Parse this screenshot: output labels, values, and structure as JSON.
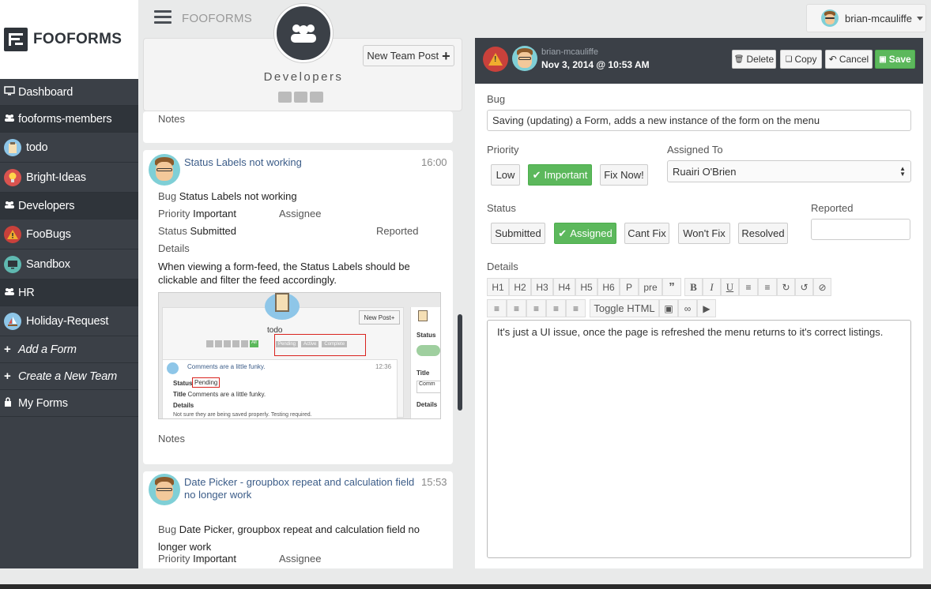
{
  "sidebar": {
    "brand": "FOOFORMS",
    "items": [
      {
        "label": "Dashboard"
      },
      {
        "label": "fooforms-members"
      },
      {
        "label": "todo"
      },
      {
        "label": "Bright-Ideas"
      },
      {
        "label": "Developers"
      },
      {
        "label": "FooBugs"
      },
      {
        "label": "Sandbox"
      },
      {
        "label": "HR"
      },
      {
        "label": "Holiday-Request"
      },
      {
        "label": "Add a Form"
      },
      {
        "label": "Create a New Team"
      },
      {
        "label": "My Forms"
      }
    ]
  },
  "topbar": {
    "brand": "FOOFORMS",
    "user": "brian-mcauliffe"
  },
  "team": {
    "name": "Developers",
    "new_post_label": "New Team Post"
  },
  "feed": {
    "card0": {
      "notes_label": "Notes"
    },
    "card1": {
      "title": "Status Labels not working",
      "time": "16:00",
      "bug_label": "Bug",
      "bug_value": "Status Labels not working",
      "priority_label": "Priority",
      "priority_value": "Important",
      "assignee_label": "Assignee",
      "status_label": "Status",
      "status_value": "Submitted",
      "reported_label": "Reported",
      "details_label": "Details",
      "details_text": "When viewing a form-feed, the Status Labels should be clickable and filter the feed accordingly.",
      "notes_label": "Notes",
      "shot": {
        "new_post": "New Post",
        "name": "todo",
        "filters": [
          "Pending",
          "Active",
          "Complete"
        ],
        "all": "All",
        "entry_title": "Comments are a little funky.",
        "entry_time": "12:36",
        "status_label": "Status",
        "status_value": "Pending",
        "title_label": "Title",
        "title_value": "Comments are a little funky.",
        "details_label": "Details",
        "details_value": "Not sure they are being saved properly. Testing required.",
        "side_status": "Status",
        "side_title": "Title",
        "side_comm": "Comm",
        "side_details": "Details"
      }
    },
    "card2": {
      "title": "Date Picker - groupbox repeat and calculation field no longer work",
      "time": "15:53",
      "bug_label": "Bug",
      "bug_value": "Date Picker, groupbox repeat and calculation field no longer work",
      "priority_label": "Priority",
      "priority_value": "Important",
      "assignee_label": "Assignee"
    }
  },
  "detail": {
    "author": "brian-mcauliffe",
    "date": "Nov 3, 2014 @ 10:53 AM",
    "buttons": {
      "delete": "Delete",
      "copy": "Copy",
      "cancel": "Cancel",
      "save": "Save"
    },
    "bug_label": "Bug",
    "bug_value": "Saving (updating) a Form, adds a new instance of the form on the menu",
    "priority_label": "Priority",
    "priority_options": [
      "Low",
      "Important",
      "Fix Now!"
    ],
    "priority_selected": "Important",
    "assigned_label": "Assigned To",
    "assigned_value": "Ruairi O'Brien",
    "status_label": "Status",
    "status_options": [
      "Submitted",
      "Assigned",
      "Cant Fix",
      "Won't Fix",
      "Resolved"
    ],
    "status_selected": "Assigned",
    "reported_label": "Reported",
    "reported_value": "",
    "details_label": "Details",
    "toolbar_row1": [
      "H1",
      "H2",
      "H3",
      "H4",
      "H5",
      "H6",
      "P",
      "pre"
    ],
    "toggle_html": "Toggle HTML",
    "details_text": "It's just a UI issue, once the page is refreshed the menu returns to it's correct listings."
  },
  "colors": {
    "sidebar": "#3b4047",
    "accent_green": "#5cb85c",
    "danger": "#c9413b"
  }
}
